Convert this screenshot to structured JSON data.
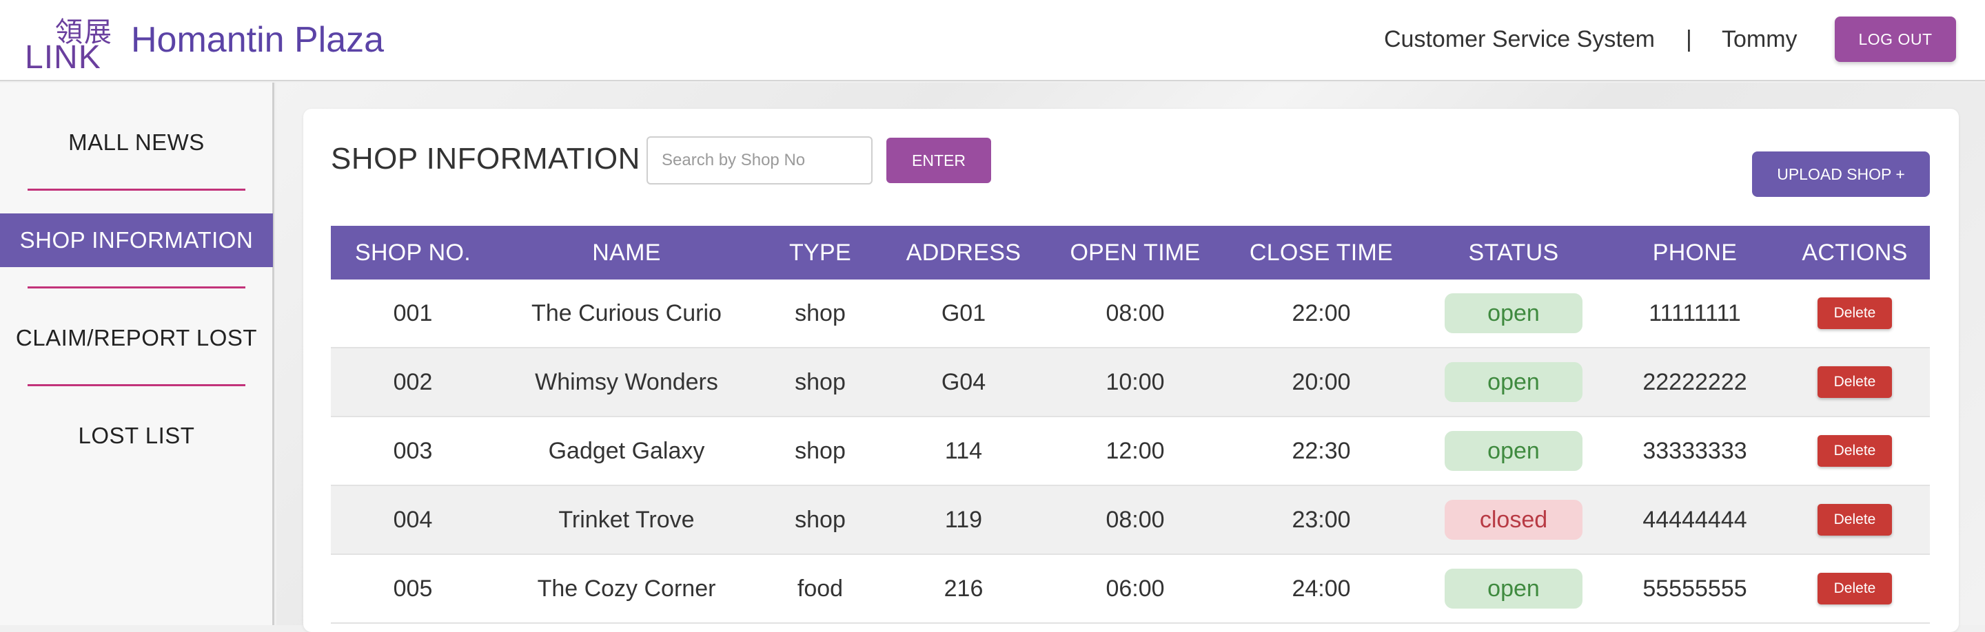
{
  "header": {
    "logo_cjk": "領展",
    "logo_text": "LINK",
    "app_title": "Homantin Plaza",
    "system_name": "Customer Service System",
    "separator": "|",
    "user_name": "Tommy",
    "logout_label": "LOG OUT",
    "brand_color": "#6b5aac",
    "accent_color": "#9a4d9f"
  },
  "sidebar": {
    "items": [
      {
        "label": "MALL NEWS",
        "active": false
      },
      {
        "label": "SHOP INFORMATION",
        "active": true
      },
      {
        "label": "CLAIM/REPORT LOST",
        "active": false
      },
      {
        "label": "LOST LIST",
        "active": false
      }
    ]
  },
  "main": {
    "title": "SHOP INFORMATION",
    "search": {
      "placeholder": "Search by Shop No",
      "value": ""
    },
    "enter_label": "ENTER",
    "upload_label": "UPLOAD SHOP +",
    "table": {
      "columns": [
        "SHOP NO.",
        "NAME",
        "TYPE",
        "ADDRESS",
        "OPEN TIME",
        "CLOSE TIME",
        "STATUS",
        "PHONE",
        "ACTIONS"
      ],
      "rows": [
        {
          "shop_no": "001",
          "name": "The Curious Curio",
          "type": "shop",
          "address": "G01",
          "open": "08:00",
          "close": "22:00",
          "status": "open",
          "phone": "11111111",
          "action": "Delete"
        },
        {
          "shop_no": "002",
          "name": "Whimsy Wonders",
          "type": "shop",
          "address": "G04",
          "open": "10:00",
          "close": "20:00",
          "status": "open",
          "phone": "22222222",
          "action": "Delete"
        },
        {
          "shop_no": "003",
          "name": "Gadget Galaxy",
          "type": "shop",
          "address": "114",
          "open": "12:00",
          "close": "22:30",
          "status": "open",
          "phone": "33333333",
          "action": "Delete"
        },
        {
          "shop_no": "004",
          "name": "Trinket Trove",
          "type": "shop",
          "address": "119",
          "open": "08:00",
          "close": "23:00",
          "status": "closed",
          "phone": "44444444",
          "action": "Delete"
        },
        {
          "shop_no": "005",
          "name": "The Cozy Corner",
          "type": "food",
          "address": "216",
          "open": "06:00",
          "close": "24:00",
          "status": "open",
          "phone": "55555555",
          "action": "Delete"
        }
      ]
    }
  }
}
